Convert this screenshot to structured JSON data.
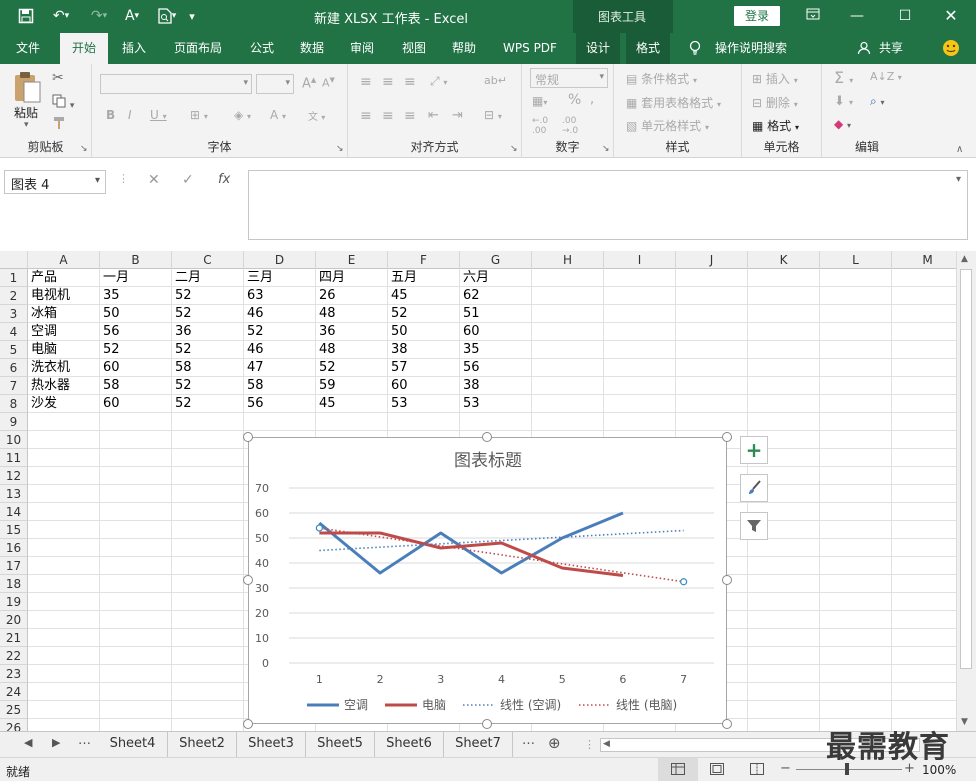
{
  "window": {
    "title": "新建 XLSX 工作表  -  Excel",
    "chart_tools": "图表工具",
    "login": "登录",
    "share": "共享",
    "tell_me": "操作说明搜索"
  },
  "tabs": [
    "文件",
    "开始",
    "插入",
    "页面布局",
    "公式",
    "数据",
    "审阅",
    "视图",
    "帮助",
    "WPS PDF",
    "设计",
    "格式"
  ],
  "ribbon": {
    "clipboard": {
      "label": "剪贴板",
      "paste": "粘贴"
    },
    "font": {
      "label": "字体"
    },
    "align": {
      "label": "对齐方式"
    },
    "number": {
      "label": "数字",
      "format": "常规"
    },
    "styles": {
      "label": "样式",
      "items": [
        "条件格式",
        "套用表格格式",
        "单元格样式"
      ]
    },
    "cells": {
      "label": "单元格",
      "items": [
        "插入",
        "删除",
        "格式"
      ]
    },
    "editing": {
      "label": "编辑"
    }
  },
  "formula": {
    "namebox": "图表 4",
    "fx": "fx"
  },
  "columns": [
    "A",
    "B",
    "C",
    "D",
    "E",
    "F",
    "G",
    "H",
    "I",
    "J",
    "K",
    "L",
    "M"
  ],
  "rows": [
    "1",
    "2",
    "3",
    "4",
    "5",
    "6",
    "7",
    "8",
    "9",
    "10",
    "11",
    "12",
    "13",
    "14",
    "15",
    "16",
    "17",
    "18",
    "19",
    "20",
    "21",
    "22",
    "23",
    "24",
    "25",
    "26"
  ],
  "table": [
    [
      "产品",
      "一月",
      "二月",
      "三月",
      "四月",
      "五月",
      "六月"
    ],
    [
      "电视机",
      "35",
      "52",
      "63",
      "26",
      "45",
      "62"
    ],
    [
      "冰箱",
      "50",
      "52",
      "46",
      "48",
      "52",
      "51"
    ],
    [
      "空调",
      "56",
      "36",
      "52",
      "36",
      "50",
      "60"
    ],
    [
      "电脑",
      "52",
      "52",
      "46",
      "48",
      "38",
      "35"
    ],
    [
      "洗衣机",
      "60",
      "58",
      "47",
      "52",
      "57",
      "56"
    ],
    [
      "热水器",
      "58",
      "52",
      "58",
      "59",
      "60",
      "38"
    ],
    [
      "沙发",
      "60",
      "52",
      "56",
      "45",
      "53",
      "53"
    ]
  ],
  "chart_data": {
    "type": "line",
    "title": "图表标题",
    "x": [
      1,
      2,
      3,
      4,
      5,
      6,
      7
    ],
    "ylim": [
      0,
      70
    ],
    "yticks": [
      "0",
      "10",
      "20",
      "30",
      "40",
      "50",
      "60",
      "70"
    ],
    "xticks": [
      "1",
      "2",
      "3",
      "4",
      "5",
      "6",
      "7"
    ],
    "grid": true,
    "legend_position": "bottom",
    "series": [
      {
        "name": "空调",
        "values": [
          56,
          36,
          52,
          36,
          50,
          60
        ],
        "color": "#4a7ebb",
        "style": "solid"
      },
      {
        "name": "电脑",
        "values": [
          52,
          52,
          46,
          48,
          38,
          35
        ],
        "color": "#be4b48",
        "style": "solid"
      },
      {
        "name": "线性 (空调)",
        "trend": [
          45,
          53
        ],
        "color": "#4a7ebb",
        "style": "dotted"
      },
      {
        "name": "线性 (电脑)",
        "trend": [
          54,
          32.5
        ],
        "color": "#be4b48",
        "style": "dotted"
      }
    ]
  },
  "sheets": [
    "Sheet4",
    "Sheet2",
    "Sheet3",
    "Sheet5",
    "Sheet6",
    "Sheet7"
  ],
  "status": {
    "ready": "就绪",
    "zoom": "100%"
  },
  "watermark": "最需教育"
}
